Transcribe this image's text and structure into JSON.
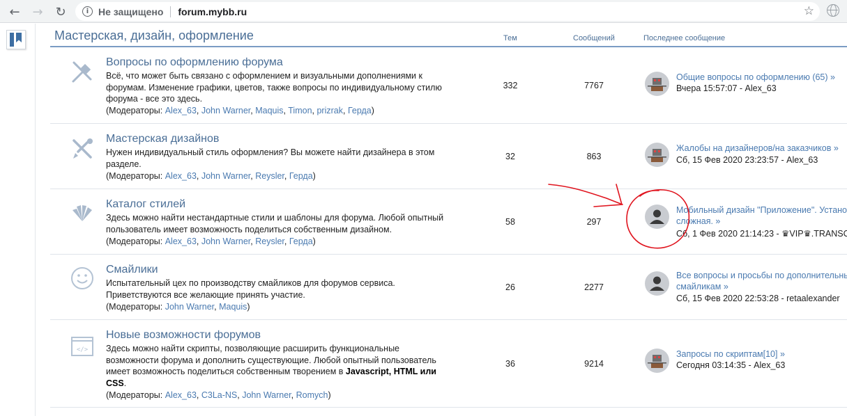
{
  "browser": {
    "security_label": "Не защищено",
    "url": "forum.mybb.ru"
  },
  "category": {
    "title": "Мастерская, дизайн, оформление",
    "col_topics": "Тем",
    "col_posts": "Сообщений",
    "col_last": "Последнее сообщение"
  },
  "moderators_label": "Модераторы:",
  "forums": [
    {
      "title": "Вопросы по оформлению форума",
      "icon": "tools-icon",
      "desc_lines": [
        "Всё, что может быть связано с оформлением и визуальными дополнениями к",
        "форумам. Изменение графики, цветов, также вопросы по индивидуальному стилю",
        "форума - все это здесь."
      ],
      "moderators": [
        "Alex_63",
        "John Warner",
        "Maquis",
        "Timon",
        "prizrak",
        "Герда"
      ],
      "topics": "332",
      "posts": "7767",
      "last_title": [
        "Общие вопросы по оформлению (65) »"
      ],
      "last_meta": "Вчера 15:57:07 - Alex_63",
      "avatar": "robot"
    },
    {
      "title": "Мастерская дизайнов",
      "icon": "brush-pencil-icon",
      "desc_lines": [
        "Нужен индивидуальный стиль оформления? Вы можете найти дизайнера в этом",
        "разделе."
      ],
      "moderators": [
        "Alex_63",
        "John Warner",
        "Reysler",
        "Герда"
      ],
      "topics": "32",
      "posts": "863",
      "last_title": [
        "Жалобы на дизайнеров/на заказчиков »"
      ],
      "last_meta": "Сб, 15 Фев 2020 23:23:57 - Alex_63",
      "avatar": "robot"
    },
    {
      "title": "Каталог стилей",
      "icon": "swatches-icon",
      "desc_lines": [
        "Здесь можно найти нестандартные стили и шаблоны для форума. Любой опытный",
        "пользователь имеет возможность поделиться собственным дизайном."
      ],
      "moderators": [
        "Alex_63",
        "John Warner",
        "Reysler",
        "Герда"
      ],
      "topics": "58",
      "posts": "297",
      "last_title": [
        "Мобильный дизайн \"Приложение\". Устано",
        "сложная. »"
      ],
      "last_meta": "Сб, 1 Фев 2020 21:14:23 - ♛VIP♛.TRANSC",
      "avatar": "person"
    },
    {
      "title": "Смайлики",
      "icon": "smiley-icon",
      "desc_lines": [
        "Испытательный цех по производству смайликов для форумов сервиса.",
        "Приветствуются все желающие принять участие."
      ],
      "moderators": [
        "John Warner",
        "Maquis"
      ],
      "topics": "26",
      "posts": "2277",
      "last_title": [
        "Все вопросы и просьбы по дополнительны",
        "смайликам »"
      ],
      "last_meta": "Сб, 15 Фев 2020 22:53:28 - retaalexander",
      "avatar": "person"
    },
    {
      "title": "Новые возможности форумов",
      "icon": "code-window-icon",
      "desc_lines": [
        "Здесь можно найти скрипты, позволяющие расширить функциональные",
        "возможности форума и дополнить существующие. Любой опытный пользователь",
        "имеет возможность поделиться собственным творением в "
      ],
      "desc_bold_1": "Javascript, HTML или",
      "desc_bold_2": "CSS",
      "desc_end": ".",
      "moderators": [
        "Alex_63",
        "C3La-NS",
        "John Warner",
        "Romych"
      ],
      "topics": "36",
      "posts": "9214",
      "last_title": [
        "Запросы по скриптам[10] »"
      ],
      "last_meta": "Сегодня 03:14:35 - Alex_63",
      "avatar": "robot"
    }
  ],
  "colors": {
    "link": "#4a7ab0",
    "heading": "#4a6e96",
    "annotation": "#e0141e"
  }
}
